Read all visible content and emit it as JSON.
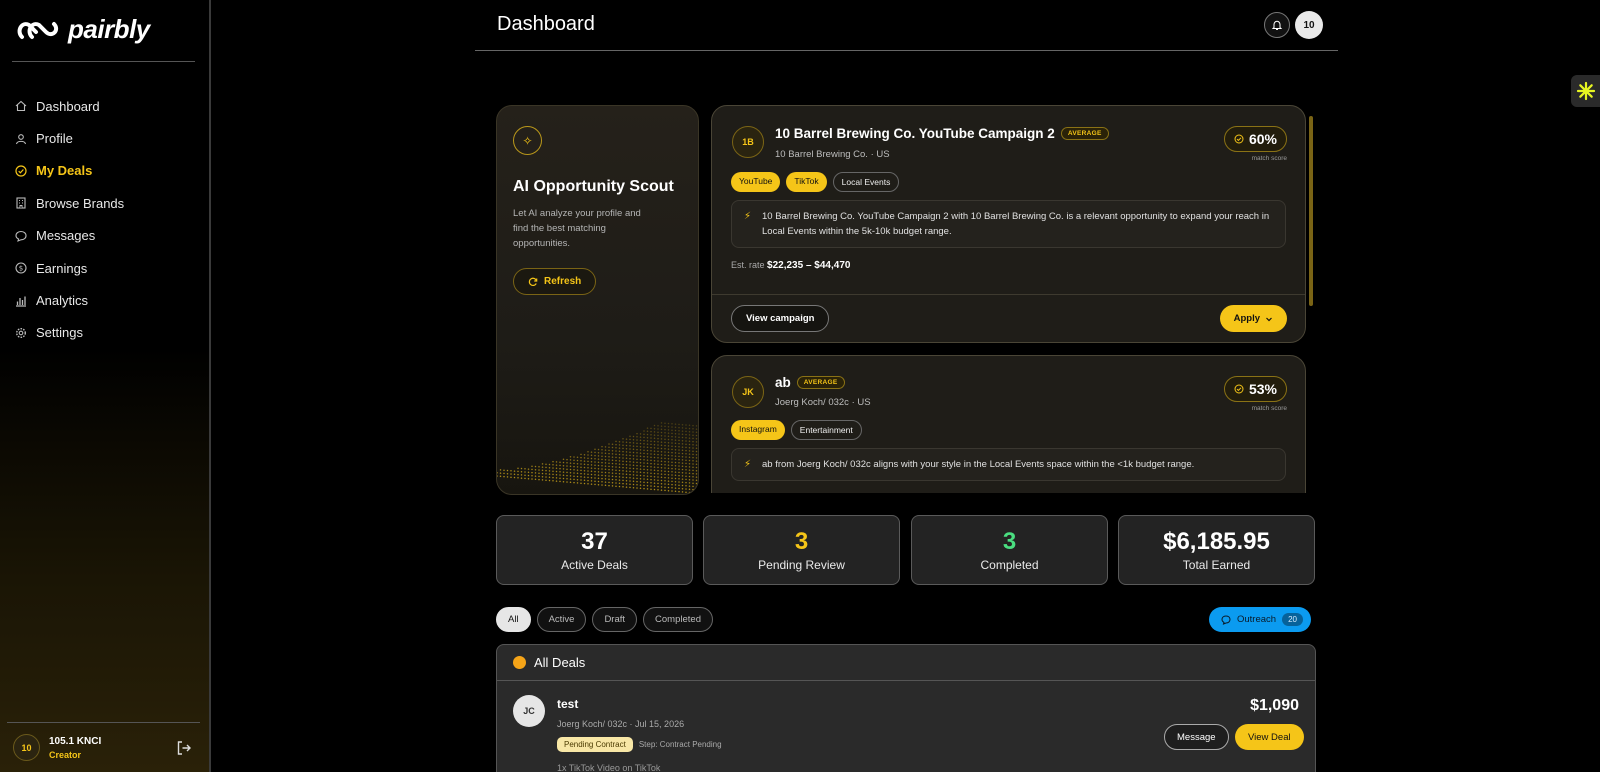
{
  "brand": {
    "name": "pairbly"
  },
  "sidebar": {
    "items": [
      {
        "label": "Dashboard",
        "icon": "home-icon"
      },
      {
        "label": "Profile",
        "icon": "user-icon"
      },
      {
        "label": "My Deals",
        "icon": "check-circle-icon",
        "active": true
      },
      {
        "label": "Browse Brands",
        "icon": "building-icon"
      },
      {
        "label": "Messages",
        "icon": "chat-icon"
      },
      {
        "label": "Earnings",
        "icon": "dollar-icon"
      },
      {
        "label": "Analytics",
        "icon": "bar-chart-icon"
      },
      {
        "label": "Settings",
        "icon": "gear-icon"
      }
    ],
    "user": {
      "initials": "10",
      "name": "105.1 KNCI",
      "role": "Creator"
    }
  },
  "header": {
    "title": "Dashboard",
    "avatar_initials": "10"
  },
  "scout": {
    "title": "AI Opportunity Scout",
    "description": "Let AI analyze your profile and find the best matching opportunities.",
    "refresh_label": "Refresh"
  },
  "opportunities": [
    {
      "initials": "1B",
      "title": "10 Barrel Brewing Co. YouTube Campaign 2",
      "badge": "AVERAGE",
      "brand": "10 Barrel Brewing Co.",
      "country": "US",
      "score": "60%",
      "score_label": "match score",
      "tags": [
        "YouTube",
        "TikTok",
        "Local Events"
      ],
      "reason": "10 Barrel Brewing Co. YouTube Campaign 2 with 10 Barrel Brewing Co. is a relevant opportunity to expand your reach in Local Events within the 5k-10k budget range.",
      "rate_label": "Est. rate",
      "rate_value": "$22,235 – $44,470",
      "view_label": "View campaign",
      "apply_label": "Apply"
    },
    {
      "initials": "JK",
      "title": "ab",
      "badge": "AVERAGE",
      "brand": "Joerg Koch/ 032c",
      "country": "US",
      "score": "53%",
      "score_label": "match score",
      "tags": [
        "Instagram",
        "Entertainment"
      ],
      "reason": "ab from Joerg Koch/ 032c aligns with your style in the Local Events space within the <1k budget range."
    }
  ],
  "stats": [
    {
      "value": "37",
      "label": "Active Deals",
      "color": "#ffffff"
    },
    {
      "value": "3",
      "label": "Pending Review",
      "color": "#f5c518"
    },
    {
      "value": "3",
      "label": "Completed",
      "color": "#4ade80"
    },
    {
      "value": "$6,185.95",
      "label": "Total Earned",
      "color": "#ffffff"
    }
  ],
  "filters": [
    "All",
    "Active",
    "Draft",
    "Completed"
  ],
  "outreach": {
    "label": "Outreach",
    "count": "20"
  },
  "deals": {
    "heading": "All Deals",
    "items": [
      {
        "initials": "JC",
        "title": "test",
        "meta": "Joerg Koch/ 032c · Jul 15, 2026",
        "status": "Pending Contract",
        "step": "Step: Contract Pending",
        "deliverable": "1x TikTok Video on TikTok",
        "amount": "$1,090",
        "message_label": "Message",
        "view_label": "View Deal"
      }
    ]
  }
}
